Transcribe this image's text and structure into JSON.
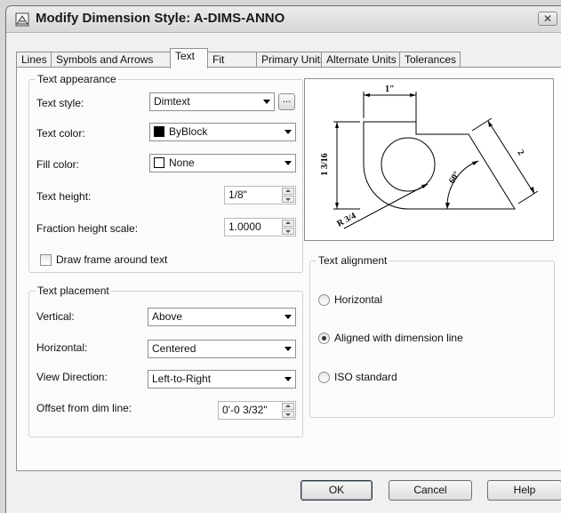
{
  "window": {
    "title": "Modify Dimension Style: A-DIMS-ANNO",
    "close_glyph": "✕"
  },
  "tabs": [
    {
      "label": "Lines"
    },
    {
      "label": "Symbols and Arrows"
    },
    {
      "label": "Text"
    },
    {
      "label": "Fit"
    },
    {
      "label": "Primary Units"
    },
    {
      "label": "Alternate Units"
    },
    {
      "label": "Tolerances"
    }
  ],
  "text_appearance": {
    "title": "Text appearance",
    "text_style_label": "Text style:",
    "text_style_value": "Dimtext",
    "browse_label": "...",
    "text_color_label": "Text color:",
    "text_color_value": "ByBlock",
    "fill_color_label": "Fill color:",
    "fill_color_value": "None",
    "text_height_label": "Text height:",
    "text_height_value": "1/8\"",
    "fraction_label": "Fraction height scale:",
    "fraction_value": "1.0000",
    "frame_label": "Draw frame around text"
  },
  "text_placement": {
    "title": "Text placement",
    "vertical_label": "Vertical:",
    "vertical_value": "Above",
    "horizontal_label": "Horizontal:",
    "horizontal_value": "Centered",
    "view_direction_label": "View Direction:",
    "view_direction_value": "Left-to-Right",
    "offset_label": "Offset from dim line:",
    "offset_value": "0'-0 3/32\""
  },
  "preview": {
    "dim_top": "1\"",
    "dim_left": "1 3/16",
    "dim_right": "2",
    "dim_angle": "60°",
    "dim_radius": "R 3/4"
  },
  "text_alignment": {
    "title": "Text alignment",
    "options": [
      {
        "label": "Horizontal",
        "selected": false
      },
      {
        "label": "Aligned with dimension line",
        "selected": true
      },
      {
        "label": "ISO standard",
        "selected": false
      }
    ]
  },
  "buttons": {
    "ok": "OK",
    "cancel": "Cancel",
    "help": "Help"
  }
}
